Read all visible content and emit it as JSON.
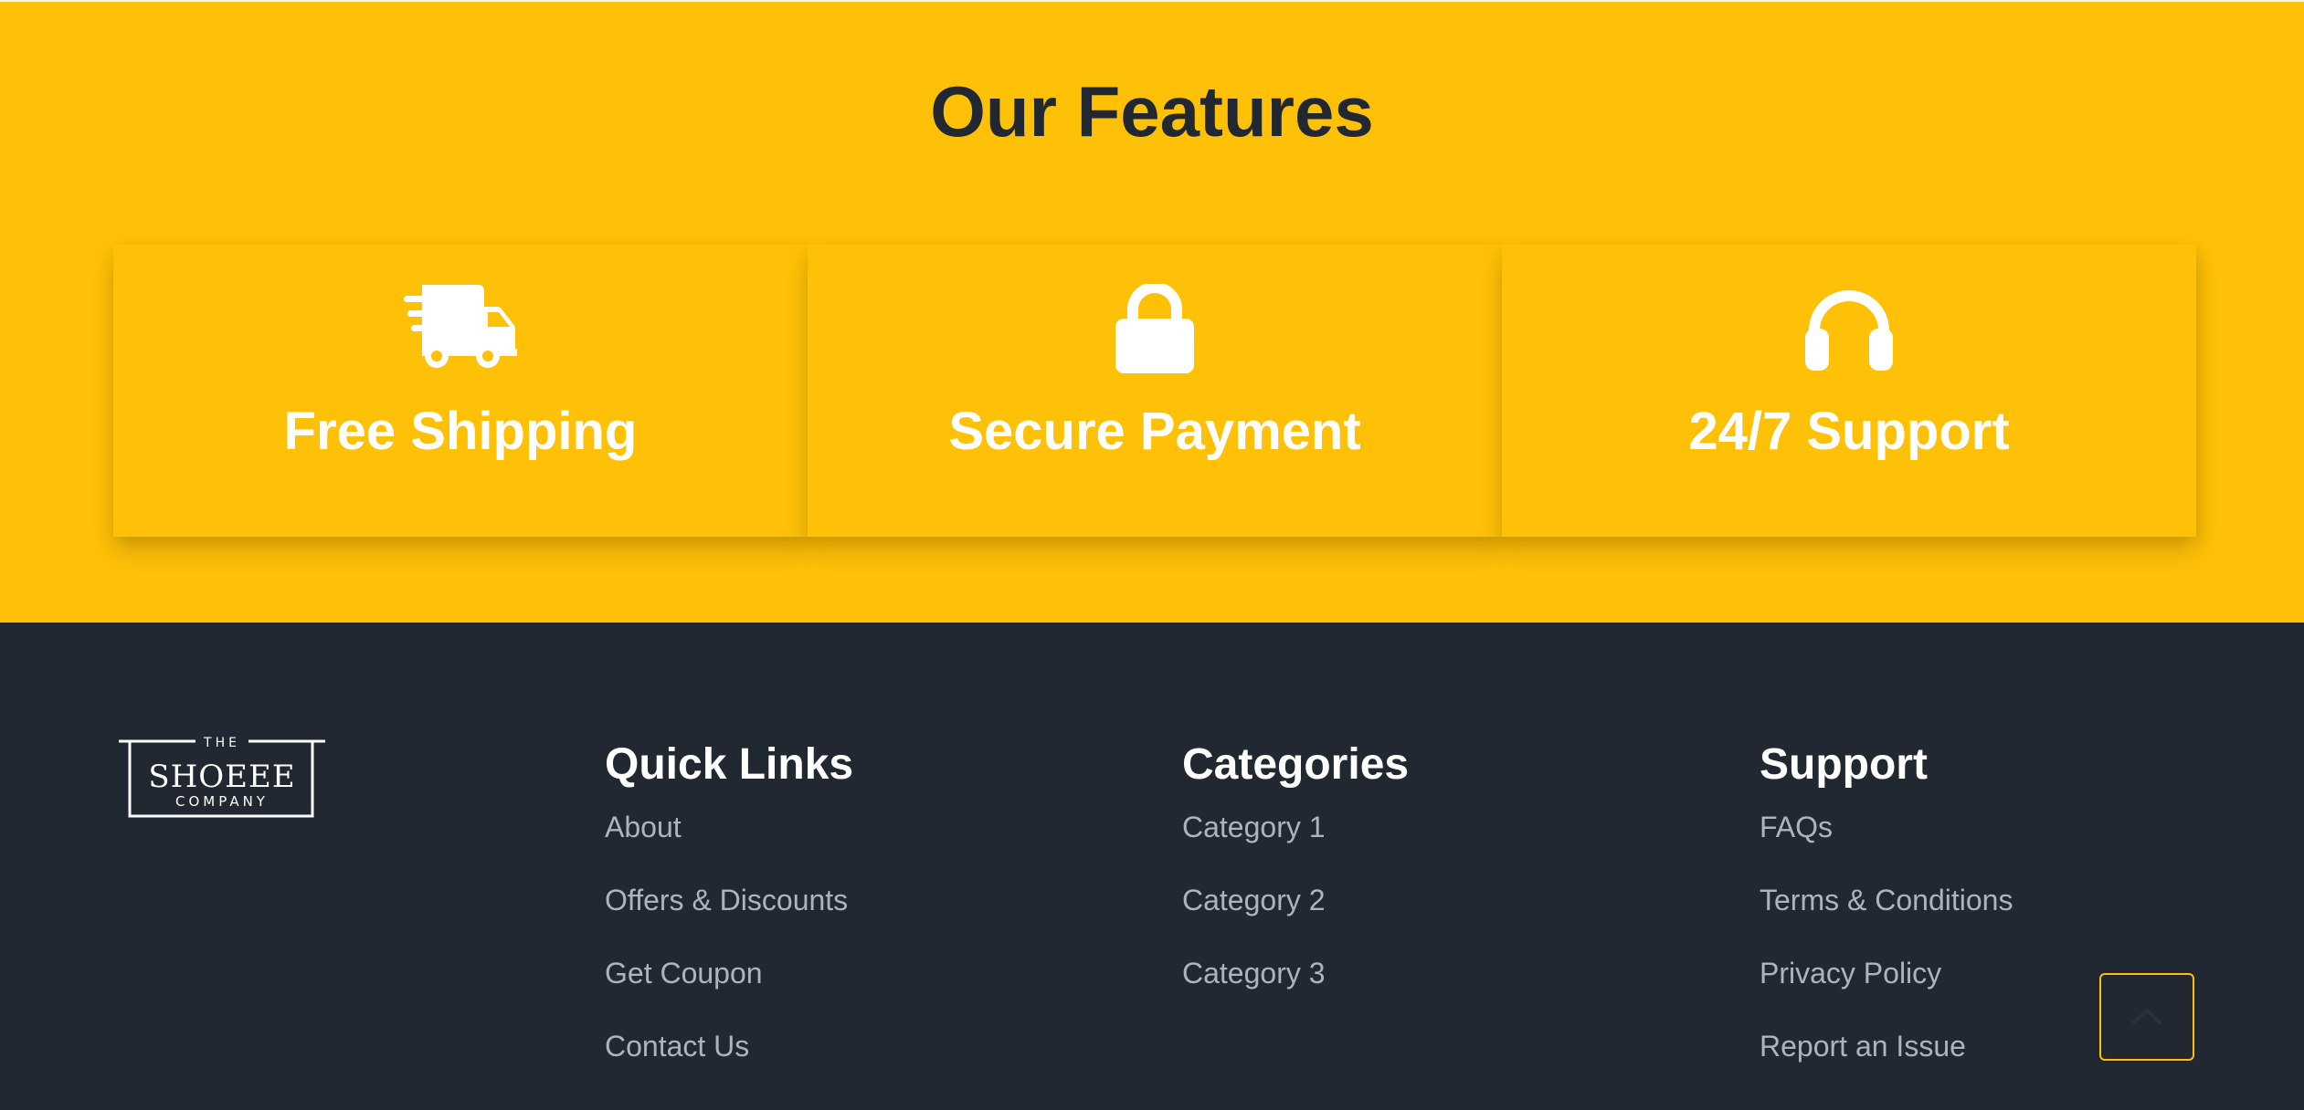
{
  "features": {
    "title": "Our Features",
    "cards": [
      {
        "icon": "shipping-truck-icon",
        "label": "Free Shipping"
      },
      {
        "icon": "lock-icon",
        "label": "Secure Payment"
      },
      {
        "icon": "headphones-icon",
        "label": "24/7 Support"
      }
    ]
  },
  "footer": {
    "logo": {
      "top": "THE",
      "brand": "SHOEEE",
      "bottom": "COMPANY"
    },
    "quick_links": {
      "title": "Quick Links",
      "links": [
        "About",
        "Offers & Discounts",
        "Get Coupon",
        "Contact Us"
      ]
    },
    "categories": {
      "title": "Categories",
      "links": [
        "Category 1",
        "Category 2",
        "Category 3"
      ]
    },
    "support": {
      "title": "Support",
      "links": [
        "FAQs",
        "Terms & Conditions",
        "Privacy Policy",
        "Report an Issue"
      ]
    },
    "back_to_top_icon": "chevron-up-icon"
  },
  "colors": {
    "accent": "#FFC107",
    "footer_bg": "#222831",
    "heading_dark": "#222831",
    "link_muted": "#aeb4bd"
  }
}
